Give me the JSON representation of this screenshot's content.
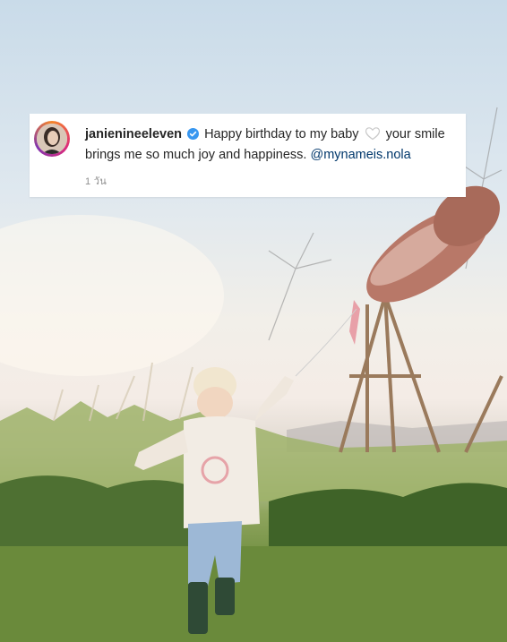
{
  "post": {
    "username": "janienineeleven",
    "caption_part1": "Happy birthday to my baby",
    "caption_part2": "your smile brings me so much joy and happiness.",
    "mention": "@mynameis.nola",
    "time": "1 วัน"
  },
  "icons": {
    "verified": "verified-badge-icon",
    "heart": "heart-outline-icon"
  },
  "colors": {
    "verified_blue": "#3897f0",
    "mention_blue": "#00376b",
    "time_gray": "#8e8e8e"
  }
}
